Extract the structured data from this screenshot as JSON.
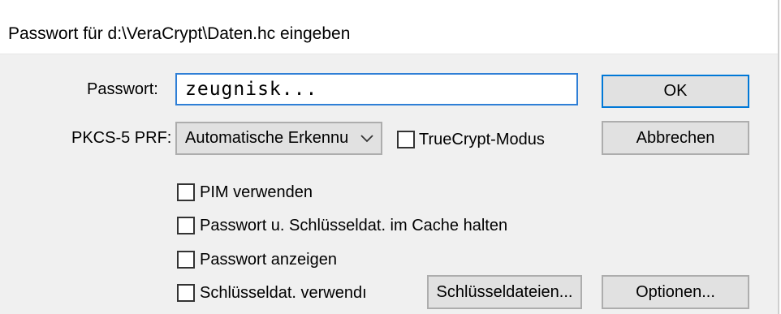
{
  "title": "Passwort für d:\\VeraCrypt\\Daten.hc eingeben",
  "password": {
    "label": "Passwort:",
    "value": "zeugnisk..."
  },
  "prf": {
    "label": "PKCS-5 PRF:",
    "selected": "Automatische Erkennu"
  },
  "truecrypt_mode": {
    "label": "TrueCrypt-Modus",
    "checked": false
  },
  "options": {
    "use_pim": {
      "label": "PIM verwenden",
      "checked": false
    },
    "cache": {
      "label": "Passwort u. Schlüsseldat. im Cache halten",
      "checked": false
    },
    "show_password": {
      "label": "Passwort anzeigen",
      "checked": false
    },
    "use_keyfiles": {
      "label": "Schlüsseldat. verwendı",
      "checked": false
    }
  },
  "buttons": {
    "ok": "OK",
    "cancel": "Abbrechen",
    "keyfiles": "Schlüsseldateien...",
    "options": "Optionen..."
  },
  "colors": {
    "focus_border": "#2f7fd6",
    "dialog_bg": "#f0f0f0",
    "button_bg": "#e1e1e1"
  },
  "icons": {
    "dropdown": "chevron-down-icon"
  }
}
